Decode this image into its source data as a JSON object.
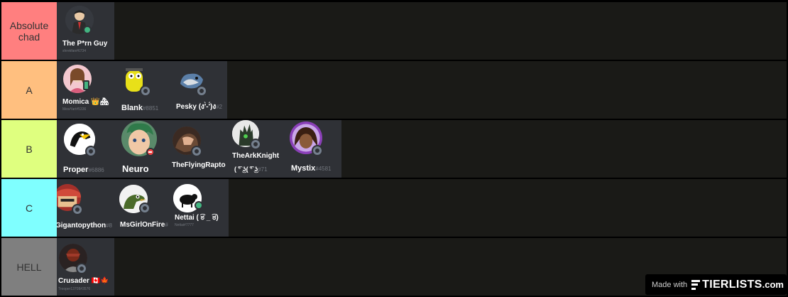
{
  "tiers": [
    {
      "label": "Absolute chad",
      "color": "#ff7f7f",
      "items": [
        {
          "name": "The P*rn Guy",
          "disc": "",
          "sub": "shrekfan#6734",
          "status": "online"
        }
      ]
    },
    {
      "label": "A",
      "color": "#ffbf7f",
      "items": [
        {
          "name": "Momica 👑🏘",
          "disc": "",
          "sub": "MewYart#5336",
          "status": "mobile"
        },
        {
          "name": "Blank",
          "disc": "#8851",
          "sub": "",
          "status": "offline"
        },
        {
          "name": "Pesky (ง'̀-'́)ง",
          "disc": "#2",
          "sub": "",
          "status": "offline"
        }
      ]
    },
    {
      "label": "B",
      "color": "#dfff7f",
      "items": [
        {
          "name": "Proper",
          "disc": "#6886",
          "sub": "",
          "status": "offline"
        },
        {
          "name": "Neuro",
          "disc": "",
          "sub": "",
          "status": "dnd"
        },
        {
          "name": "TheFlyingRapto",
          "disc": "",
          "sub": "",
          "status": "offline"
        },
        {
          "name": "TheArkKnight",
          "disc": "",
          "sub": "",
          "line2": "( ͡° ͜ʖ( ͡° ͜ʖ",
          "line2_disc": "#71",
          "status": "offline"
        },
        {
          "name": "Mystix",
          "disc": "#4581",
          "sub": "",
          "status": "offline"
        }
      ]
    },
    {
      "label": "C",
      "color": "#7fffff",
      "items": [
        {
          "name": "Gigantopython",
          "disc": "#8",
          "sub": "",
          "status": "offline"
        },
        {
          "name": "MsGirlOnFire",
          "disc": "#",
          "sub": "",
          "status": "offline"
        },
        {
          "name": "Nettai ( ͡ಠ _ ͡ಠ)",
          "disc": "",
          "sub": "Nettai#7777",
          "status": "online"
        }
      ]
    },
    {
      "label": "HELL",
      "color": "#7f7f7f",
      "items": [
        {
          "name": "Crusader 🇨🇦🍁",
          "disc": "",
          "sub": "Trooper13708#3576",
          "status": "offline"
        }
      ]
    }
  ],
  "watermark": {
    "made_with": "Made with",
    "brand": "TIERLISTS",
    "tld": ".com"
  },
  "colors": {
    "row_background": "#1a1a17",
    "card_background": "#2f3136",
    "discriminator": "#72767d"
  }
}
